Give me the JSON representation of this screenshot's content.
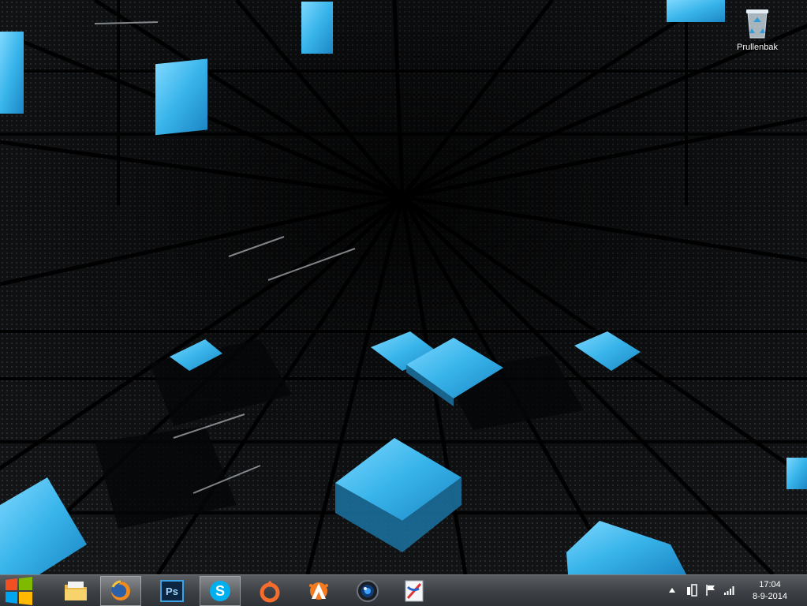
{
  "desktop": {
    "icons": [
      {
        "label": "Prullenbak",
        "icon": "recycle-bin-icon"
      }
    ]
  },
  "taskbar": {
    "start": {
      "icon": "windows-logo-icon"
    },
    "pinned": [
      {
        "name": "file-explorer",
        "icon": "folder-icon",
        "active": false
      },
      {
        "name": "firefox",
        "icon": "firefox-icon",
        "active": true
      },
      {
        "name": "photoshop",
        "icon": "photoshop-icon",
        "text": "Ps",
        "active": false
      },
      {
        "name": "skype",
        "icon": "skype-icon",
        "text": "S",
        "active": true
      },
      {
        "name": "origin",
        "icon": "origin-icon",
        "active": false
      },
      {
        "name": "avast",
        "icon": "avast-icon",
        "active": false
      },
      {
        "name": "webcam",
        "icon": "camera-lens-icon",
        "active": false
      },
      {
        "name": "paint",
        "icon": "paint-icon",
        "active": false
      }
    ],
    "tray": {
      "icons": [
        "show-hidden-icons-icon",
        "device-icon",
        "flag-icon",
        "network-signal-icon"
      ],
      "time": "17:04",
      "date": "8-9-2014"
    }
  },
  "colors": {
    "accent_blue": "#3fb7ec",
    "taskbar": "#3c4044"
  }
}
